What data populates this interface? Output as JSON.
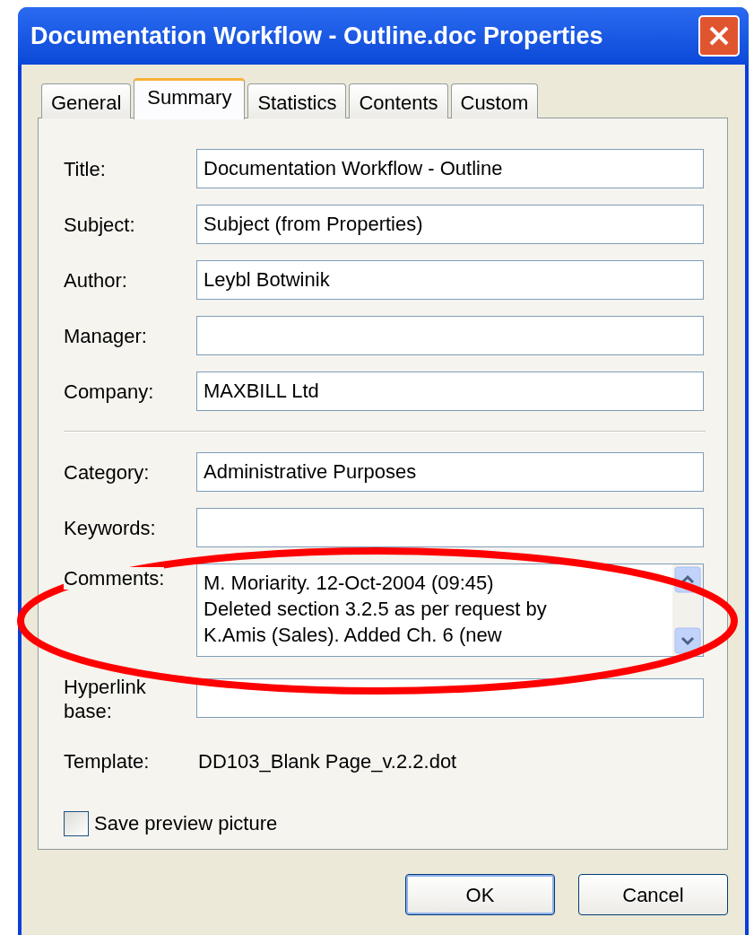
{
  "window": {
    "title": "Documentation Workflow - Outline.doc Properties"
  },
  "tabs": [
    {
      "label": "General",
      "selected": false
    },
    {
      "label": "Summary",
      "selected": true
    },
    {
      "label": "Statistics",
      "selected": false
    },
    {
      "label": "Contents",
      "selected": false
    },
    {
      "label": "Custom",
      "selected": false
    }
  ],
  "fields_group_1": [
    {
      "label": "Title:",
      "value": "Documentation Workflow - Outline"
    },
    {
      "label": "Subject:",
      "value": "Subject (from Properties)"
    },
    {
      "label": "Author:",
      "value": "Leybl Botwinik"
    },
    {
      "label": "Manager:"
    },
    {
      "label": "Company:",
      "value": "MAXBILL Ltd"
    }
  ],
  "fields_group_2": [
    {
      "label": "Category:",
      "value": "Administrative Purposes"
    },
    {
      "label": "Keywords:"
    }
  ],
  "comments": {
    "label": "Comments:",
    "lines": [
      "M. Moriarity. 12-Oct-2004 (09:45)",
      "Deleted section 3.2.5 as per request by",
      "K.Amis (Sales). Added Ch. 6 (new"
    ]
  },
  "hyperlink_base": {
    "label_lines": [
      "Hyperlink",
      "base:"
    ]
  },
  "template": {
    "label": "Template:",
    "value": "DD103_Blank Page_v.2.2.dot"
  },
  "save_preview": {
    "label": "Save preview picture",
    "checked": false
  },
  "buttons": [
    {
      "label": "OK",
      "default": true
    },
    {
      "label": "Cancel",
      "default": false
    }
  ]
}
